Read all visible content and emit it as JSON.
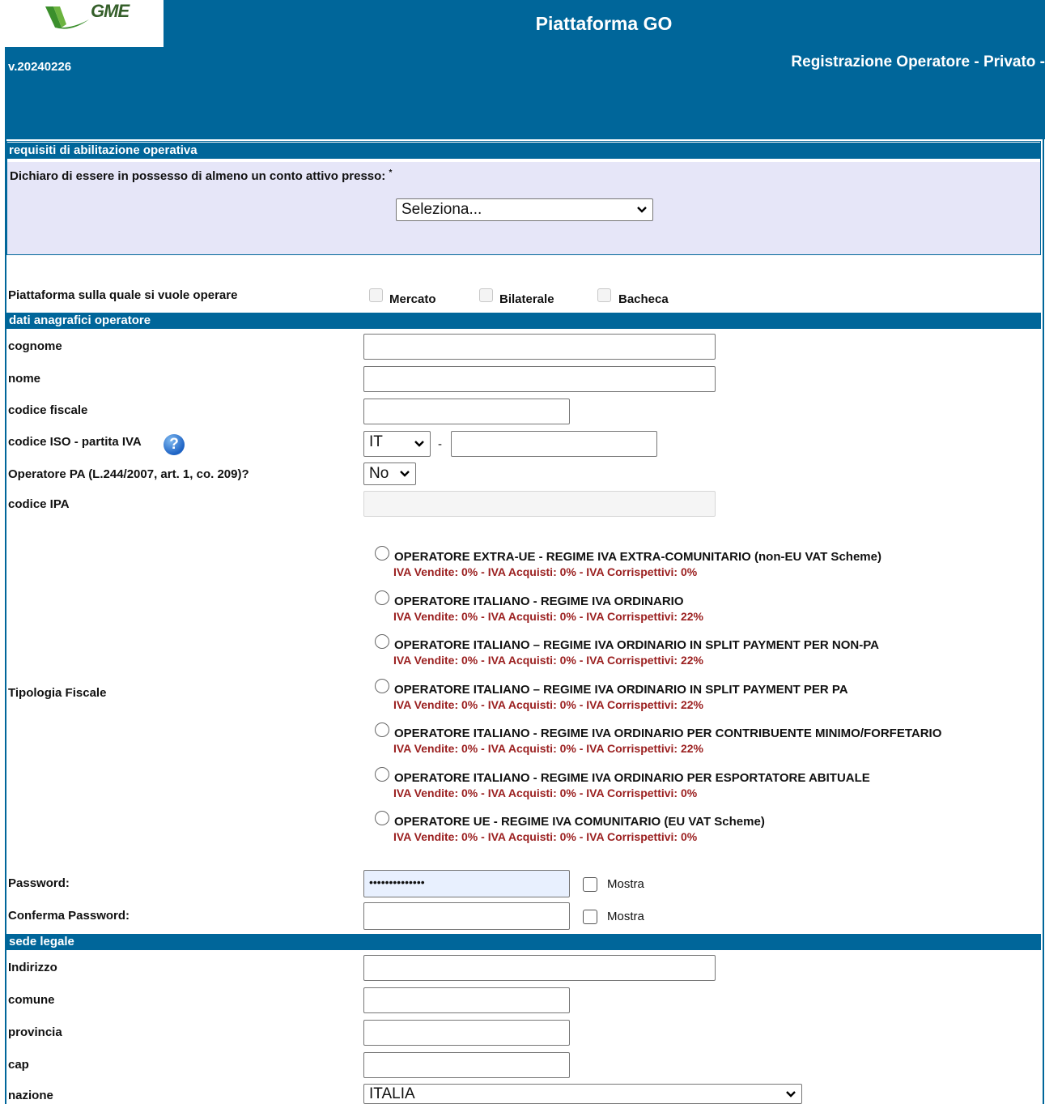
{
  "header": {
    "logo_text": "GME",
    "title": "Piattaforma GO",
    "version": "v.20240226",
    "subtitle": "Registrazione Operatore - Privato -"
  },
  "requisiti": {
    "section_title": "requisiti di abilitazione operativa",
    "declaration_label": "Dichiaro di essere in possesso di almeno un conto attivo presso:",
    "required_mark": "*",
    "select_value": "Seleziona..."
  },
  "piattaforma": {
    "label": "Piattaforma sulla quale si vuole operare",
    "options": [
      "Mercato",
      "Bilaterale",
      "Bacheca"
    ]
  },
  "anagrafica": {
    "section_title": "dati anagrafici operatore",
    "cognome_label": "cognome",
    "nome_label": "nome",
    "codice_fiscale_label": "codice fiscale",
    "iso_piva_label": "codice ISO - partita IVA",
    "iso_value": "IT",
    "separator": "-",
    "help_glyph": "?",
    "operatore_pa_label": "Operatore PA (L.244/2007, art. 1, co. 209)?",
    "operatore_pa_value": "No",
    "codice_ipa_label": "codice IPA"
  },
  "tipologia_fiscale": {
    "label": "Tipologia Fiscale",
    "options": [
      {
        "title": "OPERATORE EXTRA-UE - REGIME IVA EXTRA-COMUNITARIO (non-EU VAT Scheme)",
        "iva": "IVA Vendite: 0% - IVA Acquisti: 0% - IVA Corrispettivi: 0%"
      },
      {
        "title": "OPERATORE ITALIANO - REGIME IVA ORDINARIO",
        "iva": "IVA Vendite: 0% - IVA Acquisti: 0% - IVA Corrispettivi: 22%"
      },
      {
        "title": "OPERATORE ITALIANO – REGIME IVA ORDINARIO IN SPLIT PAYMENT PER NON-PA",
        "iva": "IVA Vendite: 0% - IVA Acquisti: 0% - IVA Corrispettivi: 22%"
      },
      {
        "title": "OPERATORE ITALIANO – REGIME IVA ORDINARIO IN SPLIT PAYMENT PER PA",
        "iva": "IVA Vendite: 0% - IVA Acquisti: 0% - IVA Corrispettivi: 22%"
      },
      {
        "title": "OPERATORE ITALIANO - REGIME IVA ORDINARIO PER CONTRIBUENTE MINIMO/FORFETARIO",
        "iva": "IVA Vendite: 0% - IVA Acquisti: 0% - IVA Corrispettivi: 22%"
      },
      {
        "title": "OPERATORE ITALIANO - REGIME IVA ORDINARIO PER ESPORTATORE ABITUALE",
        "iva": "IVA Vendite: 0% - IVA Acquisti: 0% - IVA Corrispettivi: 0%"
      },
      {
        "title": "OPERATORE UE - REGIME IVA COMUNITARIO (EU VAT Scheme)",
        "iva": "IVA Vendite: 0% - IVA Acquisti: 0% - IVA Corrispettivi: 0%"
      }
    ]
  },
  "password": {
    "password_label": "Password:",
    "password_value": "••••••••••••••",
    "confirm_label": "Conferma Password:",
    "show_label": "Mostra"
  },
  "sede_legale": {
    "section_title": "sede legale",
    "indirizzo_label": "Indirizzo",
    "comune_label": "comune",
    "provincia_label": "provincia",
    "cap_label": "cap",
    "nazione_label": "nazione",
    "nazione_value": "ITALIA"
  },
  "colors": {
    "brand_blue": "#00669a",
    "request_box_bg": "#e6e6f8",
    "iva_text": "#9b2020"
  }
}
